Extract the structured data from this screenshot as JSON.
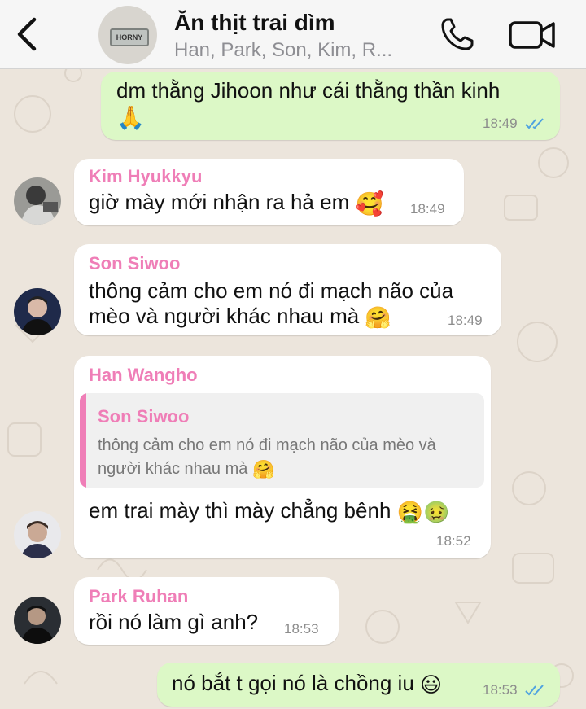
{
  "header": {
    "title": "Ăn thịt trai dìm",
    "members": "Han, Park, Son, Kim, R...",
    "avatar_text": "HORNY",
    "back_icon": "chevron-left-icon",
    "call_icon": "phone-icon",
    "video_icon": "video-camera-icon"
  },
  "colors": {
    "outgoing_bubble": "#dcf8c6",
    "incoming_bubble": "#ffffff",
    "sender_name": "#ef7eb7",
    "read_ticks": "#4fa3e0",
    "chat_background": "#ece5dc"
  },
  "messages": [
    {
      "direction": "outgoing",
      "text_line1": "dm thằng Jihoon như cái thằng thần kinh",
      "emoji": "🙏",
      "time": "18:49",
      "status": "read"
    },
    {
      "direction": "incoming",
      "sender": "Kim Hyukkyu",
      "text": "giờ mày mới nhận ra hả em",
      "emoji": "🥰",
      "time": "18:49"
    },
    {
      "direction": "incoming",
      "sender": "Son Siwoo",
      "text_line1": "thông cảm cho em nó đi mạch não của",
      "text_line2": "mèo và người khác nhau mà",
      "emoji": "🤗",
      "time": "18:49"
    },
    {
      "direction": "incoming",
      "sender": "Han Wangho",
      "quote": {
        "sender": "Son Siwoo",
        "line1": "thông cảm cho em nó đi mạch não của mèo và",
        "line2": "người khác nhau mà",
        "emoji": "🤗"
      },
      "text": "em trai mày thì mày chẳng bênh",
      "emoji1": "🤮",
      "emoji2": "🤢",
      "time": "18:52"
    },
    {
      "direction": "incoming",
      "sender": "Park Ruhan",
      "text": "rồi nó làm gì anh?",
      "time": "18:53"
    },
    {
      "direction": "outgoing",
      "text": "nó bắt t gọi nó là chồng iu",
      "emoji": "😃",
      "time": "18:53",
      "status": "read"
    }
  ]
}
